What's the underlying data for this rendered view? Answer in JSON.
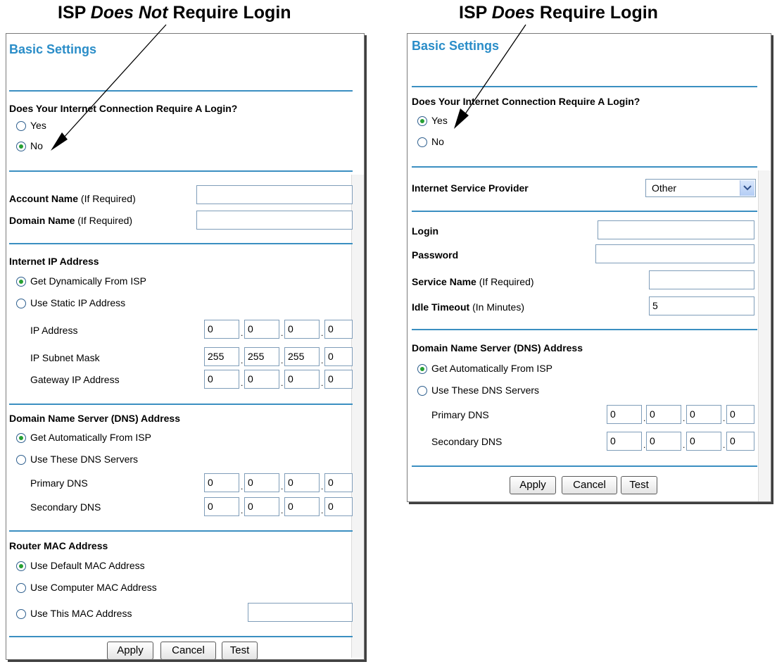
{
  "headers": {
    "left": {
      "pre": "ISP ",
      "em": "Does Not",
      "post": " Require Login"
    },
    "right": {
      "pre": "ISP ",
      "em": "Does",
      "post": " Require Login"
    }
  },
  "left": {
    "title": "Basic Settings",
    "login_question": "Does Your Internet Connection Require A Login?",
    "yes": "Yes",
    "no": "No",
    "account_name_bold": "Account Name",
    "account_name_note": " (If Required)",
    "domain_name_bold": "Domain Name",
    "domain_name_note": " (If Required)",
    "internet_ip_heading": "Internet IP Address",
    "get_dynamic": "Get Dynamically From ISP",
    "use_static": "Use Static IP Address",
    "ip_address_label": "IP Address",
    "subnet_label": "IP Subnet Mask",
    "gateway_label": "Gateway IP Address",
    "ip_address": [
      "0",
      "0",
      "0",
      "0"
    ],
    "subnet": [
      "255",
      "255",
      "255",
      "0"
    ],
    "gateway": [
      "0",
      "0",
      "0",
      "0"
    ],
    "dns_heading": "Domain Name Server (DNS) Address",
    "dns_auto": "Get Automatically From ISP",
    "dns_use": "Use These DNS Servers",
    "primary_label": "Primary DNS",
    "secondary_label": "Secondary DNS",
    "primary": [
      "0",
      "0",
      "0",
      "0"
    ],
    "secondary": [
      "0",
      "0",
      "0",
      "0"
    ],
    "mac_heading": "Router MAC Address",
    "mac_default": "Use Default MAC Address",
    "mac_computer": "Use Computer MAC Address",
    "mac_this": "Use This MAC Address",
    "apply": "Apply",
    "cancel": "Cancel",
    "test": "Test"
  },
  "right": {
    "title": "Basic Settings",
    "login_question": "Does Your Internet Connection Require A Login?",
    "yes": "Yes",
    "no": "No",
    "isp_label": "Internet Service Provider",
    "isp_value": "Other",
    "login_label": "Login",
    "password_label": "Password",
    "service_bold": "Service Name",
    "service_note": " (If Required)",
    "idle_bold": "Idle Timeout",
    "idle_note": " (In Minutes)",
    "idle_value": "5",
    "dns_heading": "Domain Name Server (DNS) Address",
    "dns_auto": "Get Automatically From ISP",
    "dns_use": "Use These DNS Servers",
    "primary_label": "Primary DNS",
    "secondary_label": "Secondary DNS",
    "primary": [
      "0",
      "0",
      "0",
      "0"
    ],
    "secondary": [
      "0",
      "0",
      "0",
      "0"
    ],
    "apply": "Apply",
    "cancel": "Cancel",
    "test": "Test"
  },
  "colors": {
    "title_blue": "#2a8dc8",
    "rule_blue": "#3b8fc1",
    "radio_green": "#26a033"
  }
}
